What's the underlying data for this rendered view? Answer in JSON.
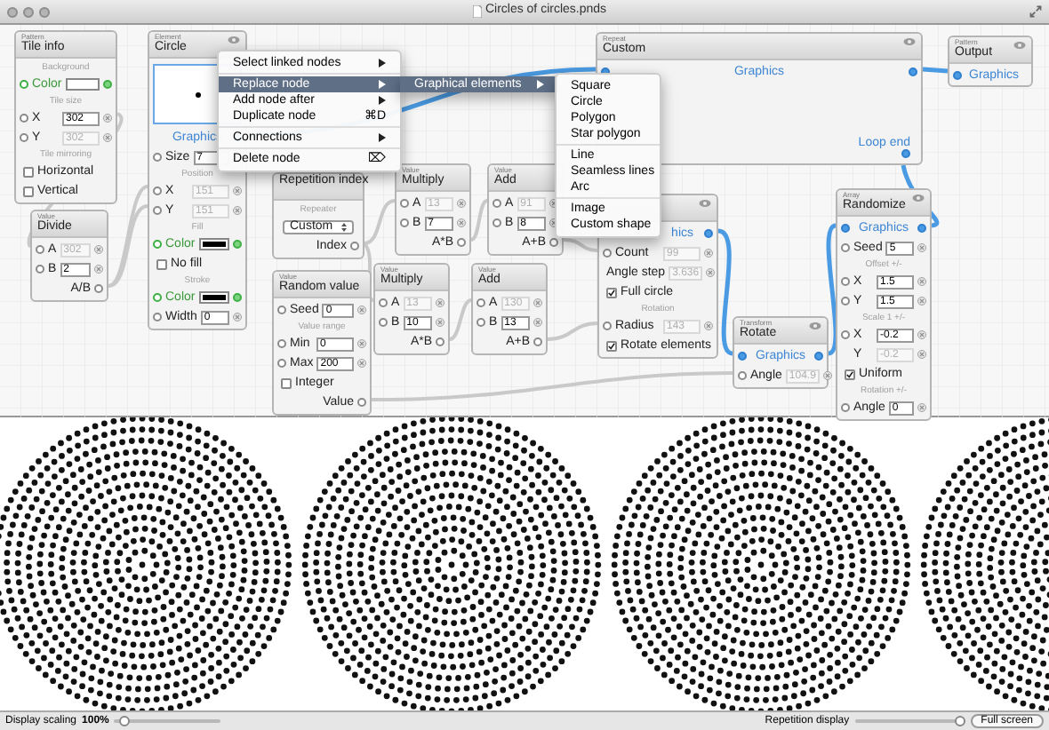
{
  "window": {
    "title": "Circles of circles.pnds"
  },
  "nodes": [
    {
      "category": "Pattern",
      "title": "Tile info",
      "rows": [
        {
          "kind": "section",
          "text": "Background"
        },
        {
          "kind": "color",
          "label": "Color",
          "color": "#ffffff"
        },
        {
          "kind": "section",
          "text": "Tile size"
        },
        {
          "kind": "field",
          "label": "X",
          "value": "302",
          "disabled": false
        },
        {
          "kind": "field",
          "label": "Y",
          "value": "302",
          "disabled": true
        },
        {
          "kind": "section",
          "text": "Tile mirroring"
        },
        {
          "kind": "check",
          "label": "Horizontal",
          "checked": false
        },
        {
          "kind": "check",
          "label": "Vertical",
          "checked": false
        }
      ]
    },
    {
      "category": "Value",
      "title": "Divide",
      "rows": [
        {
          "kind": "field",
          "label": "A",
          "value": "302",
          "disabled": true
        },
        {
          "kind": "field",
          "label": "B",
          "value": "2",
          "disabled": false
        },
        {
          "kind": "output",
          "label": "A/B"
        }
      ]
    },
    {
      "category": "Element",
      "title": "Circle",
      "eye": true,
      "rows": [
        {
          "kind": "preview"
        },
        {
          "kind": "graphics_out",
          "label": "Graphics"
        },
        {
          "kind": "field",
          "label": "Size",
          "value": "7",
          "disabled": false
        },
        {
          "kind": "section",
          "text": "Position"
        },
        {
          "kind": "field",
          "label": "X",
          "value": "151",
          "disabled": true
        },
        {
          "kind": "field",
          "label": "Y",
          "value": "151",
          "disabled": true
        },
        {
          "kind": "section",
          "text": "Fill"
        },
        {
          "kind": "color",
          "label": "Color",
          "color": "#000000"
        },
        {
          "kind": "check",
          "label": "No fill",
          "checked": false
        },
        {
          "kind": "section",
          "text": "Stroke"
        },
        {
          "kind": "color",
          "label": "Color",
          "color": "#000000"
        },
        {
          "kind": "field",
          "label": "Width",
          "value": "0",
          "disabled": false
        }
      ]
    },
    {
      "category": "Repeat",
      "title": "Custom",
      "eye": true,
      "rows": [
        {
          "kind": "graphics",
          "label": "Graphics"
        },
        {
          "kind": "loop_end",
          "label": "Loop end"
        }
      ]
    },
    {
      "category": "Pattern",
      "title": "Output",
      "eye": true,
      "rows": [
        {
          "kind": "graphics_in",
          "label": "Graphics"
        }
      ]
    },
    {
      "title": "Repetition index",
      "rows": [
        {
          "kind": "section",
          "text": "Repeater"
        },
        {
          "kind": "select",
          "value": "Custom"
        },
        {
          "kind": "output",
          "label": "Index"
        }
      ]
    },
    {
      "category": "Value",
      "title": "Multiply",
      "rows": [
        {
          "kind": "field",
          "label": "A",
          "value": "13",
          "disabled": true
        },
        {
          "kind": "field",
          "label": "B",
          "value": "7",
          "disabled": false
        },
        {
          "kind": "output",
          "label": "A*B"
        }
      ]
    },
    {
      "category": "Value",
      "title": "Add",
      "rows": [
        {
          "kind": "field",
          "label": "A",
          "value": "91",
          "disabled": true
        },
        {
          "kind": "field",
          "label": "B",
          "value": "8",
          "disabled": false
        },
        {
          "kind": "output",
          "label": "A+B"
        }
      ]
    },
    {
      "category": "Value",
      "title": "Multiply",
      "rows": [
        {
          "kind": "field",
          "label": "A",
          "value": "13",
          "disabled": true
        },
        {
          "kind": "field",
          "label": "B",
          "value": "10",
          "disabled": false
        },
        {
          "kind": "output",
          "label": "A*B"
        }
      ]
    },
    {
      "category": "Value",
      "title": "Add",
      "rows": [
        {
          "kind": "field",
          "label": "A",
          "value": "130",
          "disabled": true
        },
        {
          "kind": "field",
          "label": "B",
          "value": "13",
          "disabled": false
        },
        {
          "kind": "output",
          "label": "A+B"
        }
      ]
    },
    {
      "category": "Value",
      "title": "Random value",
      "rows": [
        {
          "kind": "field",
          "label": "Seed",
          "value": "0",
          "disabled": false
        },
        {
          "kind": "section",
          "text": "Value range"
        },
        {
          "kind": "field",
          "label": "Min",
          "value": "0",
          "disabled": false
        },
        {
          "kind": "field",
          "label": "Max",
          "value": "200",
          "disabled": false
        },
        {
          "kind": "check",
          "label": "Integer",
          "checked": false
        },
        {
          "kind": "output",
          "label": "Value"
        }
      ]
    },
    {
      "eye": true,
      "rows": [
        {
          "kind": "graphics_out",
          "label": "hics"
        },
        {
          "kind": "field",
          "label": "Count",
          "value": "99",
          "disabled": true
        },
        {
          "kind": "field",
          "label": "Angle step",
          "value": "3.636",
          "disabled": true,
          "port": false
        },
        {
          "kind": "check",
          "label": "Full circle",
          "checked": true
        },
        {
          "kind": "section",
          "text": "Rotation"
        },
        {
          "kind": "field",
          "label": "Radius",
          "value": "143",
          "disabled": true
        },
        {
          "kind": "check",
          "label": "Rotate elements",
          "checked": true
        }
      ]
    },
    {
      "category": "Transform",
      "title": "Rotate",
      "eye": true,
      "rows": [
        {
          "kind": "graphics",
          "label": "Graphics"
        },
        {
          "kind": "field",
          "label": "Angle",
          "value": "104.9",
          "disabled": true
        }
      ]
    },
    {
      "category": "Array",
      "title": "Randomize",
      "eye": true,
      "rows": [
        {
          "kind": "graphics",
          "label": "Graphics"
        },
        {
          "kind": "field",
          "label": "Seed",
          "value": "5",
          "disabled": false
        },
        {
          "kind": "section",
          "text": "Offset +/-"
        },
        {
          "kind": "field",
          "label": "X",
          "value": "1.5",
          "disabled": false
        },
        {
          "kind": "field",
          "label": "Y",
          "value": "1.5",
          "disabled": false
        },
        {
          "kind": "section",
          "text": "Scale 1 +/-"
        },
        {
          "kind": "field",
          "label": "X",
          "value": "-0.2",
          "disabled": false
        },
        {
          "kind": "field",
          "label": "Y",
          "value": "-0.2",
          "disabled": true,
          "port": false
        },
        {
          "kind": "check",
          "label": "Uniform",
          "checked": true
        },
        {
          "kind": "section",
          "text": "Rotation +/-"
        },
        {
          "kind": "field",
          "label": "Angle",
          "value": "0",
          "disabled": false
        }
      ]
    }
  ],
  "context_menu": {
    "groups": [
      [
        {
          "label": "Select linked nodes",
          "submenu": true,
          "selected": false
        }
      ],
      [
        {
          "label": "Replace node",
          "submenu": true,
          "selected": true
        },
        {
          "label": "Add node after",
          "submenu": true,
          "selected": false
        },
        {
          "label": "Duplicate node",
          "shortcut": "⌘D",
          "selected": false
        }
      ],
      [
        {
          "label": "Connections",
          "submenu": true,
          "selected": false
        }
      ],
      [
        {
          "label": "Delete node",
          "shortcut": "⌦",
          "selected": false
        }
      ]
    ]
  },
  "replace_submenu": {
    "items": [
      {
        "label": "Graphical elements",
        "submenu": true,
        "selected": true
      }
    ]
  },
  "elements_menu": {
    "groups": [
      [
        {
          "label": "Square",
          "selected": false
        },
        {
          "label": "Circle",
          "selected": false
        },
        {
          "label": "Polygon",
          "selected": false
        },
        {
          "label": "Star polygon",
          "selected": false
        }
      ],
      [
        {
          "label": "Line",
          "selected": false
        },
        {
          "label": "Seamless lines",
          "selected": false
        },
        {
          "label": "Arc",
          "selected": false
        }
      ],
      [
        {
          "label": "Image",
          "selected": false
        },
        {
          "label": "Custom shape",
          "selected": false
        }
      ]
    ]
  },
  "bottom_bar": {
    "scaling_label": "Display scaling",
    "scaling_value": "100%",
    "scaling_slider": {
      "level": 0.1
    },
    "repetition_label": "Repetition display",
    "repetition_slider": {
      "level": 0.95
    },
    "fullscreen_button": "Full screen"
  }
}
